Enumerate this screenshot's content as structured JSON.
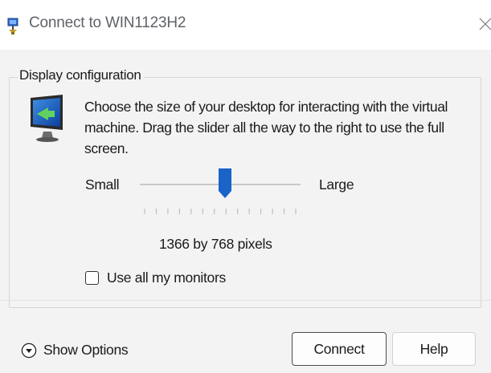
{
  "window": {
    "title": "Connect to WIN1123H2",
    "close_glyph": "╳"
  },
  "display_config": {
    "legend": "Display configuration",
    "description": "Choose the size of your desktop for interacting with the virtual machine. Drag the slider all the way to the right to use the full screen.",
    "slider": {
      "min_label": "Small",
      "max_label": "Large",
      "position_fraction": 0.53,
      "tick_count": 14
    },
    "resolution_text": "1366 by 768 pixels",
    "use_all_monitors": {
      "label": "Use all my monitors",
      "checked": false
    }
  },
  "footer": {
    "show_options_label": "Show Options",
    "connect_label": "Connect",
    "help_label": "Help"
  },
  "icons": {
    "title": "vm-connect-icon",
    "monitor": "monitor-icon",
    "options": "chevron-down-circle-icon",
    "close": "close-icon"
  },
  "colors": {
    "accent": "#1a63c9",
    "panel_bg": "#f3f3f3"
  }
}
